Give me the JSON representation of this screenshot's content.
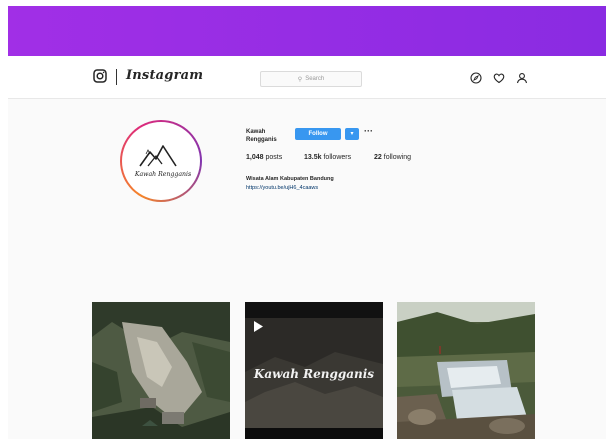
{
  "header": {
    "brand": "Instagram",
    "search_placeholder": "Search",
    "nav_icons": [
      "compass-icon",
      "heart-icon",
      "user-icon"
    ]
  },
  "profile": {
    "username": "Kawah Rengganis",
    "follow_label": "Follow",
    "dropdown_glyph": "▾",
    "more_glyph": "···",
    "logo_text": "Kawah Rengganis",
    "stats": {
      "posts_count": "1,048",
      "posts_label": "posts",
      "followers_count": "13.5k",
      "followers_label": "followers",
      "following_count": "22",
      "following_label": "following"
    },
    "bio": "Wisata Alam Kabupaten Bandung",
    "link": "https://youtu.be/ujH6_4caaws"
  },
  "posts": [
    {
      "type": "image"
    },
    {
      "type": "video",
      "overlay_text": "Kawah Rengganis"
    },
    {
      "type": "image"
    }
  ],
  "colors": {
    "banner": "#9b30e8",
    "follow_button": "#3897f0",
    "link": "#003569"
  }
}
